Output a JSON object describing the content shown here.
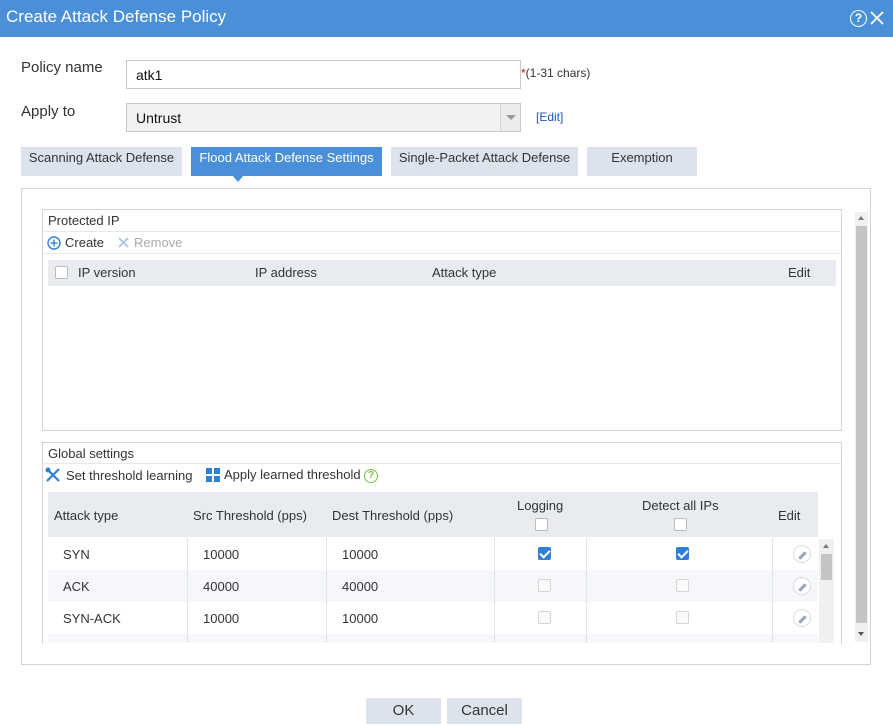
{
  "dialog": {
    "title": "Create Attack Defense Policy",
    "help_glyph": "?",
    "accent_color": "#4a90d9"
  },
  "form": {
    "policy_name_label": "Policy name",
    "policy_name_value": "atk1",
    "required_star": "*",
    "policy_name_hint": "(1-31 chars)",
    "apply_to_label": "Apply to",
    "apply_to_value": "Untrust",
    "edit_link": "[Edit]"
  },
  "tabs": [
    {
      "label": "Scanning Attack Defense",
      "active": false
    },
    {
      "label": "Flood Attack Defense Settings",
      "active": true
    },
    {
      "label": "Single-Packet Attack Defense",
      "active": false
    },
    {
      "label": "Exemption",
      "active": false
    }
  ],
  "protected_ip": {
    "title": "Protected IP",
    "create_label": "Create",
    "remove_label": "Remove",
    "columns": [
      "IP version",
      "IP address",
      "Attack type",
      "Edit"
    ]
  },
  "global_settings": {
    "title": "Global settings",
    "set_threshold_label": "Set threshold learning",
    "apply_learned_label": "Apply learned threshold",
    "help_glyph": "?",
    "columns": [
      "Attack type",
      "Src Threshold (pps)",
      "Dest Threshold (pps)",
      "Logging",
      "Detect all IPs",
      "Edit"
    ],
    "rows": [
      {
        "attack_type": "SYN",
        "src": "10000",
        "dest": "10000",
        "logging": true,
        "detect_all": true
      },
      {
        "attack_type": "ACK",
        "src": "40000",
        "dest": "40000",
        "logging": false,
        "detect_all": false
      },
      {
        "attack_type": "SYN-ACK",
        "src": "10000",
        "dest": "10000",
        "logging": false,
        "detect_all": false
      }
    ]
  },
  "footer": {
    "ok_label": "OK",
    "cancel_label": "Cancel"
  }
}
